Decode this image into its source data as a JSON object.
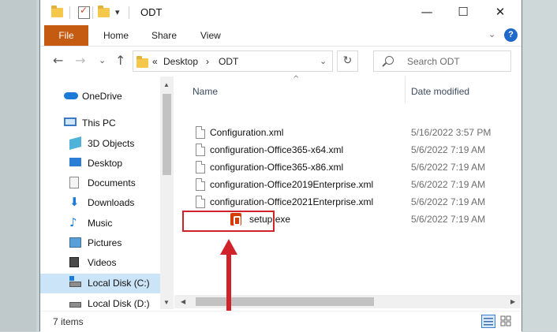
{
  "window": {
    "title": "ODT",
    "quick_access_icons": [
      "folder-icon",
      "properties-icon",
      "new-folder-icon",
      "customize-dropdown-icon"
    ]
  },
  "ribbon": {
    "tabs": [
      "File",
      "Home",
      "Share",
      "View"
    ]
  },
  "address": {
    "prefix": "«",
    "path": [
      "Desktop",
      "ODT"
    ],
    "separator": "›"
  },
  "search": {
    "placeholder": "Search ODT"
  },
  "nav": {
    "items": [
      {
        "label": "OneDrive",
        "icon": "onedrive-icon"
      },
      {
        "label": "This PC",
        "icon": "this-pc-icon"
      },
      {
        "label": "3D Objects",
        "icon": "3d-objects-icon"
      },
      {
        "label": "Desktop",
        "icon": "desktop-icon"
      },
      {
        "label": "Documents",
        "icon": "documents-icon"
      },
      {
        "label": "Downloads",
        "icon": "downloads-icon"
      },
      {
        "label": "Music",
        "icon": "music-icon"
      },
      {
        "label": "Pictures",
        "icon": "pictures-icon"
      },
      {
        "label": "Videos",
        "icon": "videos-icon"
      },
      {
        "label": "Local Disk (C:)",
        "icon": "drive-c-icon",
        "selected": true
      },
      {
        "label": "Local Disk (D:)",
        "icon": "drive-d-icon"
      }
    ]
  },
  "columns": {
    "name": "Name",
    "date": "Date modified"
  },
  "files": [
    {
      "name": "Configuration.xml",
      "date": "5/16/2022 3:57 PM",
      "icon": "xml-file-icon"
    },
    {
      "name": "configuration-Office365-x64.xml",
      "date": "5/6/2022 7:19 AM",
      "icon": "xml-file-icon"
    },
    {
      "name": "configuration-Office365-x86.xml",
      "date": "5/6/2022 7:19 AM",
      "icon": "xml-file-icon"
    },
    {
      "name": "configuration-Office2019Enterprise.xml",
      "date": "5/6/2022 7:19 AM",
      "icon": "xml-file-icon"
    },
    {
      "name": "configuration-Office2021Enterprise.xml",
      "date": "5/6/2022 7:19 AM",
      "icon": "xml-file-icon"
    },
    {
      "name": "setup.exe",
      "date": "5/6/2022 7:19 AM",
      "icon": "office-setup-icon",
      "highlighted": true
    }
  ],
  "status": {
    "item_count": "7 items"
  },
  "colors": {
    "file_tab": "#c55a11",
    "highlight": "#d0222a",
    "selection": "#cce4f7"
  }
}
